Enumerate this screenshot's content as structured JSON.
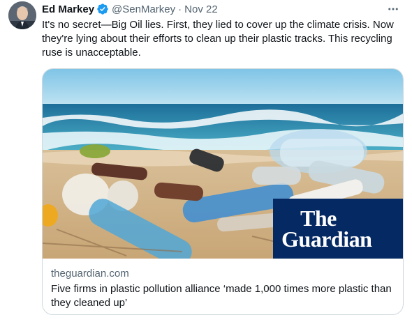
{
  "author": {
    "name": "Ed Markey",
    "handle": "@SenMarkey",
    "separator": "·",
    "date": "Nov 22"
  },
  "tweet": {
    "text": "It's no secret—Big Oil lies. First, they lied to cover up the climate crisis. Now they're lying about their efforts to clean up their plastic tracks. This recycling ruse is unacceptable."
  },
  "card": {
    "domain": "theguardian.com",
    "title": "Five firms in plastic pollution alliance ‘made 1,000 times more plastic than they cleaned up’",
    "logo_line1": "The",
    "logo_line2": "Guardian"
  },
  "icons": {
    "verified": "verified-badge-icon",
    "more": "more-options-icon"
  },
  "colors": {
    "text_primary": "#0f1419",
    "text_secondary": "#536471",
    "verified_blue": "#1d9bf0",
    "guardian_navy": "#052962",
    "card_border": "#cfd9de"
  }
}
